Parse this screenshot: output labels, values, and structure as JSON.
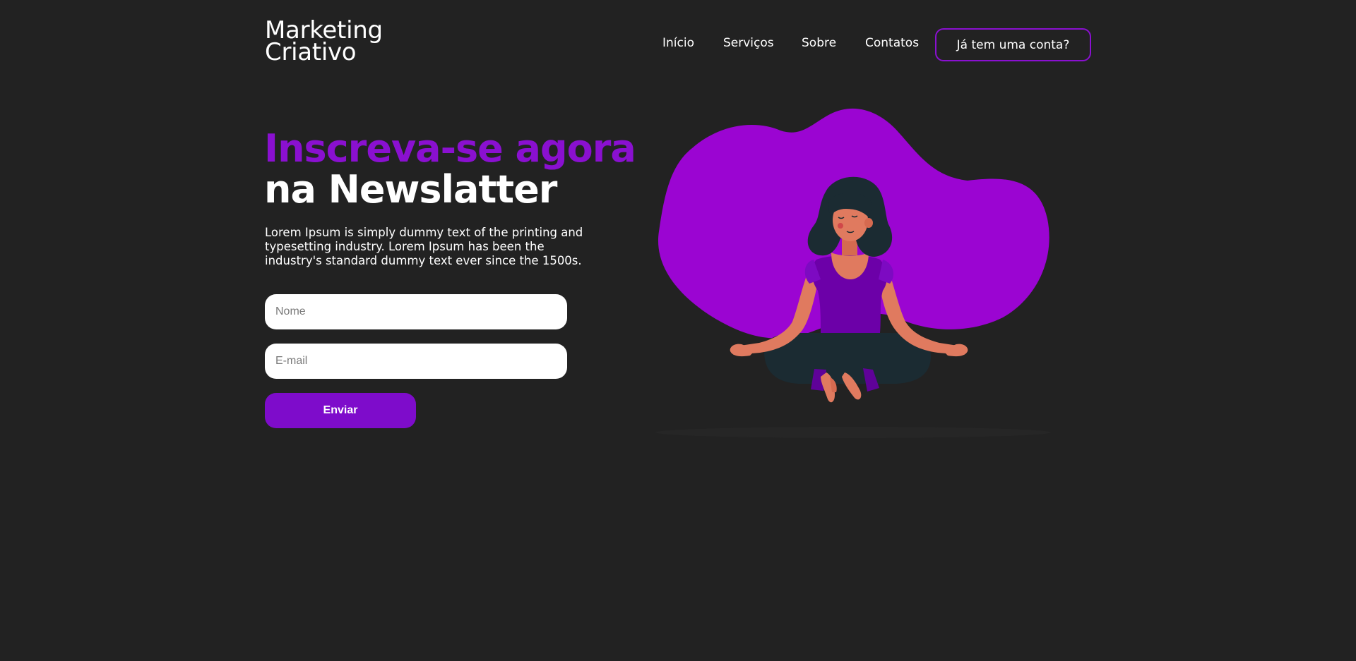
{
  "brand": {
    "line1": "Marketing",
    "line2": "Criativo"
  },
  "nav": {
    "items": [
      "Início",
      "Serviços",
      "Sobre",
      "Contatos"
    ],
    "account_button": "Já tem uma conta?"
  },
  "hero": {
    "headline_line1": "Inscreva-se agora",
    "headline_line2": "na Newslatter",
    "description": "Lorem Ipsum is simply dummy text of the printing and typesetting industry. Lorem Ipsum has been the industry's standard dummy text ever since the 1500s."
  },
  "form": {
    "name_placeholder": "Nome",
    "email_placeholder": "E-mail",
    "submit_label": "Enviar"
  },
  "colors": {
    "background": "#222222",
    "accent": "#8a10d0",
    "blob": "#9b05d2"
  },
  "icons": {
    "illustration": "meditating-woman-illustration"
  }
}
